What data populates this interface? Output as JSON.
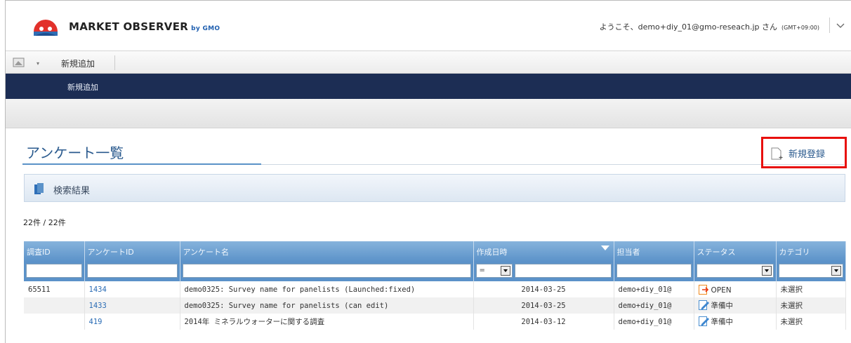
{
  "header": {
    "brand": "MARKET OBSERVER",
    "brand_sub": "by GMO",
    "welcome": "ようこそ、demo+diy_01@gmo-reseach.jp さん",
    "timezone": "(GMT+09:00)"
  },
  "menubar": {
    "new_add": "新規追加"
  },
  "navbar": {
    "item": "新規追加"
  },
  "page": {
    "title": "アンケート一覧",
    "new_button": "新規登録",
    "results_label": "検索結果",
    "count": "22件 / 22件"
  },
  "table": {
    "columns": [
      "調査ID",
      "アンケートID",
      "アンケート名",
      "作成日時",
      "担当者",
      "ステータス",
      "カテゴリ"
    ],
    "date_operator": "=",
    "rows": [
      {
        "survey_id": "65511",
        "questionnaire_id": "1434",
        "name": "demo0325: Survey name for panelists (Launched:fixed)",
        "created": "2014-03-25",
        "owner": "demo+diy_01@",
        "status": "OPEN",
        "status_icon": "open-arrow-icon",
        "category": "未選択"
      },
      {
        "survey_id": "",
        "questionnaire_id": "1433",
        "name": "demo0325: Survey name for panelists (can edit)",
        "created": "2014-03-25",
        "owner": "demo+diy_01@",
        "status": "準備中",
        "status_icon": "edit-pencil-icon",
        "category": "未選択"
      },
      {
        "survey_id": "",
        "questionnaire_id": "419",
        "name": "2014年 ミネラルウォーターに関する調査",
        "created": "2014-03-12",
        "owner": "demo+diy_01@",
        "status": "準備中",
        "status_icon": "edit-pencil-icon",
        "category": "未選択"
      }
    ]
  },
  "colors": {
    "navbar": "#1c2d54",
    "header_accent": "#5b92c9",
    "highlight_box": "#e8100d",
    "link": "#2a6cb5",
    "title": "#2a5a8e"
  }
}
